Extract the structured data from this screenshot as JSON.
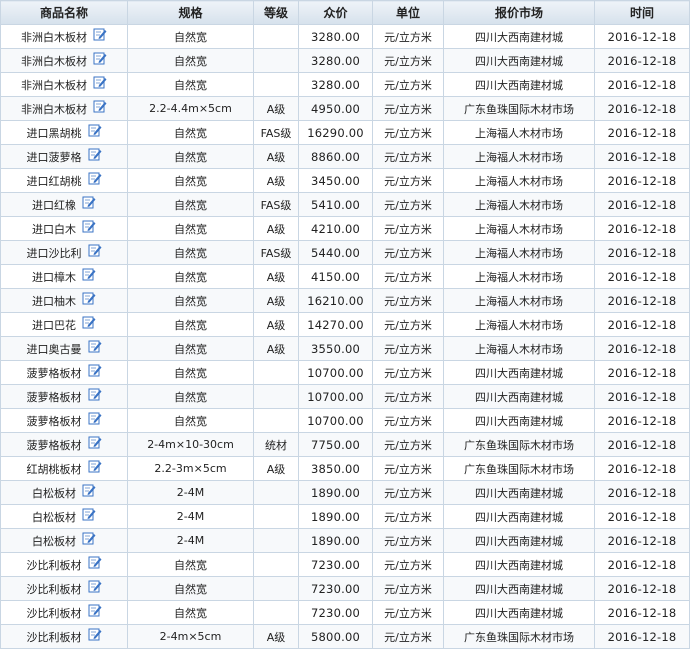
{
  "table": {
    "headers": [
      "商品名称",
      "规格",
      "等级",
      "众价",
      "单位",
      "报价市场",
      "时间"
    ],
    "rows": [
      {
        "name": "非洲白木板材",
        "spec": "自然宽",
        "grade": "",
        "price": "3280.00",
        "unit": "元/立方米",
        "market": "四川大西南建材城",
        "date": "2016-12-18"
      },
      {
        "name": "非洲白木板材",
        "spec": "自然宽",
        "grade": "",
        "price": "3280.00",
        "unit": "元/立方米",
        "market": "四川大西南建材城",
        "date": "2016-12-18"
      },
      {
        "name": "非洲白木板材",
        "spec": "自然宽",
        "grade": "",
        "price": "3280.00",
        "unit": "元/立方米",
        "market": "四川大西南建材城",
        "date": "2016-12-18"
      },
      {
        "name": "非洲白木板材",
        "spec": "2.2-4.4m×5cm",
        "grade": "A级",
        "price": "4950.00",
        "unit": "元/立方米",
        "market": "广东鱼珠国际木材市场",
        "date": "2016-12-18"
      },
      {
        "name": "进口黑胡桃",
        "spec": "自然宽",
        "grade": "FAS级",
        "price": "16290.00",
        "unit": "元/立方米",
        "market": "上海福人木材市场",
        "date": "2016-12-18"
      },
      {
        "name": "进口菠萝格",
        "spec": "自然宽",
        "grade": "A级",
        "price": "8860.00",
        "unit": "元/立方米",
        "market": "上海福人木材市场",
        "date": "2016-12-18"
      },
      {
        "name": "进口红胡桃",
        "spec": "自然宽",
        "grade": "A级",
        "price": "3450.00",
        "unit": "元/立方米",
        "market": "上海福人木材市场",
        "date": "2016-12-18"
      },
      {
        "name": "进口红橡",
        "spec": "自然宽",
        "grade": "FAS级",
        "price": "5410.00",
        "unit": "元/立方米",
        "market": "上海福人木材市场",
        "date": "2016-12-18"
      },
      {
        "name": "进口白木",
        "spec": "自然宽",
        "grade": "A级",
        "price": "4210.00",
        "unit": "元/立方米",
        "market": "上海福人木材市场",
        "date": "2016-12-18"
      },
      {
        "name": "进口沙比利",
        "spec": "自然宽",
        "grade": "FAS级",
        "price": "5440.00",
        "unit": "元/立方米",
        "market": "上海福人木材市场",
        "date": "2016-12-18"
      },
      {
        "name": "进口樟木",
        "spec": "自然宽",
        "grade": "A级",
        "price": "4150.00",
        "unit": "元/立方米",
        "market": "上海福人木材市场",
        "date": "2016-12-18"
      },
      {
        "name": "进口柚木",
        "spec": "自然宽",
        "grade": "A级",
        "price": "16210.00",
        "unit": "元/立方米",
        "market": "上海福人木材市场",
        "date": "2016-12-18"
      },
      {
        "name": "进口巴花",
        "spec": "自然宽",
        "grade": "A级",
        "price": "14270.00",
        "unit": "元/立方米",
        "market": "上海福人木材市场",
        "date": "2016-12-18"
      },
      {
        "name": "进口奥古曼",
        "spec": "自然宽",
        "grade": "A级",
        "price": "3550.00",
        "unit": "元/立方米",
        "market": "上海福人木材市场",
        "date": "2016-12-18"
      },
      {
        "name": "菠萝格板材",
        "spec": "自然宽",
        "grade": "",
        "price": "10700.00",
        "unit": "元/立方米",
        "market": "四川大西南建材城",
        "date": "2016-12-18"
      },
      {
        "name": "菠萝格板材",
        "spec": "自然宽",
        "grade": "",
        "price": "10700.00",
        "unit": "元/立方米",
        "market": "四川大西南建材城",
        "date": "2016-12-18"
      },
      {
        "name": "菠萝格板材",
        "spec": "自然宽",
        "grade": "",
        "price": "10700.00",
        "unit": "元/立方米",
        "market": "四川大西南建材城",
        "date": "2016-12-18"
      },
      {
        "name": "菠萝格板材",
        "spec": "2-4m×10-30cm",
        "grade": "统材",
        "price": "7750.00",
        "unit": "元/立方米",
        "market": "广东鱼珠国际木材市场",
        "date": "2016-12-18"
      },
      {
        "name": "红胡桃板材",
        "spec": "2.2-3m×5cm",
        "grade": "A级",
        "price": "3850.00",
        "unit": "元/立方米",
        "market": "广东鱼珠国际木材市场",
        "date": "2016-12-18"
      },
      {
        "name": "白松板材",
        "spec": "2-4M",
        "grade": "",
        "price": "1890.00",
        "unit": "元/立方米",
        "market": "四川大西南建材城",
        "date": "2016-12-18"
      },
      {
        "name": "白松板材",
        "spec": "2-4M",
        "grade": "",
        "price": "1890.00",
        "unit": "元/立方米",
        "market": "四川大西南建材城",
        "date": "2016-12-18"
      },
      {
        "name": "白松板材",
        "spec": "2-4M",
        "grade": "",
        "price": "1890.00",
        "unit": "元/立方米",
        "market": "四川大西南建材城",
        "date": "2016-12-18"
      },
      {
        "name": "沙比利板材",
        "spec": "自然宽",
        "grade": "",
        "price": "7230.00",
        "unit": "元/立方米",
        "market": "四川大西南建材城",
        "date": "2016-12-18"
      },
      {
        "name": "沙比利板材",
        "spec": "自然宽",
        "grade": "",
        "price": "7230.00",
        "unit": "元/立方米",
        "market": "四川大西南建材城",
        "date": "2016-12-18"
      },
      {
        "name": "沙比利板材",
        "spec": "自然宽",
        "grade": "",
        "price": "7230.00",
        "unit": "元/立方米",
        "market": "四川大西南建材城",
        "date": "2016-12-18"
      },
      {
        "name": "沙比利板材",
        "spec": "2-4m×5cm",
        "grade": "A级",
        "price": "5800.00",
        "unit": "元/立方米",
        "market": "广东鱼珠国际木材市场",
        "date": "2016-12-18"
      }
    ]
  },
  "colors": {
    "header_bg": "#dde6ef",
    "border": "#c9d6e3",
    "icon_blue": "#3a73c4"
  },
  "icons": {
    "row_action": "edit-note-icon"
  }
}
